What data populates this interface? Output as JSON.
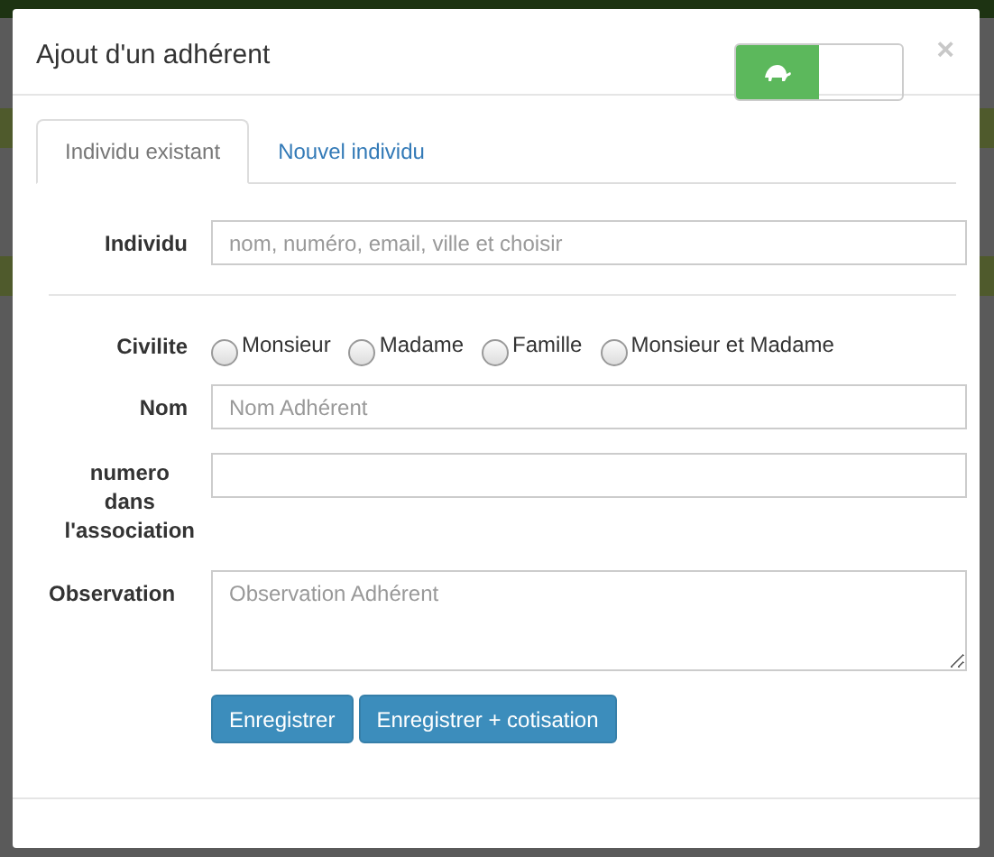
{
  "modal": {
    "title": "Ajout d'un adhérent",
    "toggle": {
      "on": true
    },
    "close": "×",
    "tabs": [
      {
        "label": "Individu existant",
        "selected": true
      },
      {
        "label": "Nouvel individu",
        "selected": false
      }
    ],
    "individu": {
      "label": "Individu",
      "placeholder": "nom, numéro, email, ville et choisir"
    },
    "fields": [
      {
        "kind": "radio",
        "label": "Civilite",
        "options": [
          {
            "label": "Monsieur",
            "selected": false
          },
          {
            "label": "Madame",
            "selected": false
          },
          {
            "label": "Famille",
            "selected": false
          },
          {
            "label": "Monsieur et Madame",
            "selected": false
          }
        ]
      },
      {
        "kind": "input",
        "label": "Nom",
        "placeholder": "Nom Adhérent"
      },
      {
        "kind": "input",
        "label": "numero dans l'association"
      },
      {
        "kind": "textarea",
        "label": "Observation",
        "placeholder": "Observation Adhérent"
      }
    ],
    "buttons": [
      "Enregistrer",
      "Enregistrer + cotisation"
    ]
  }
}
